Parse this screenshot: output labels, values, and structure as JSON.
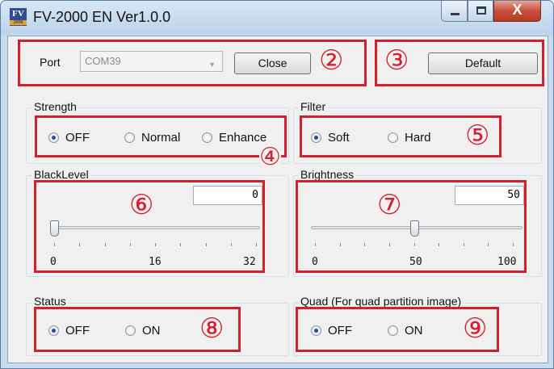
{
  "window": {
    "title": "FV-2000 EN Ver1.0.0",
    "icon_top": "FV",
    "icon_bottom": "2000",
    "close_glyph": "X"
  },
  "port": {
    "label": "Port",
    "selected": "COM39",
    "close_label": "Close",
    "default_label": "Default"
  },
  "strength": {
    "label": "Strength",
    "options": [
      {
        "label": "OFF",
        "checked": true
      },
      {
        "label": "Normal",
        "checked": false
      },
      {
        "label": "Enhance",
        "checked": false
      }
    ]
  },
  "filter": {
    "label": "Filter",
    "options": [
      {
        "label": "Soft",
        "checked": true
      },
      {
        "label": "Hard",
        "checked": false
      }
    ]
  },
  "blacklevel": {
    "label": "BlackLevel",
    "value": "0",
    "min": "0",
    "mid": "16",
    "max": "32",
    "fraction": 0
  },
  "brightness": {
    "label": "Brightness",
    "value": "50",
    "min": "0",
    "mid": "50",
    "max": "100",
    "fraction": 0.5
  },
  "status": {
    "label": "Status",
    "options": [
      {
        "label": "OFF",
        "checked": true
      },
      {
        "label": "ON",
        "checked": false
      }
    ]
  },
  "quad": {
    "label": "Quad (For quad partition image)",
    "options": [
      {
        "label": "OFF",
        "checked": true
      },
      {
        "label": "ON",
        "checked": false
      }
    ]
  },
  "callouts": {
    "n2": "②",
    "n3": "③",
    "n4": "④",
    "n5": "⑤",
    "n6": "⑥",
    "n7": "⑦",
    "n8": "⑧",
    "n9": "⑨"
  },
  "colors": {
    "callout_red": "#d4202c",
    "radio_selected": "#1c4f9c"
  }
}
